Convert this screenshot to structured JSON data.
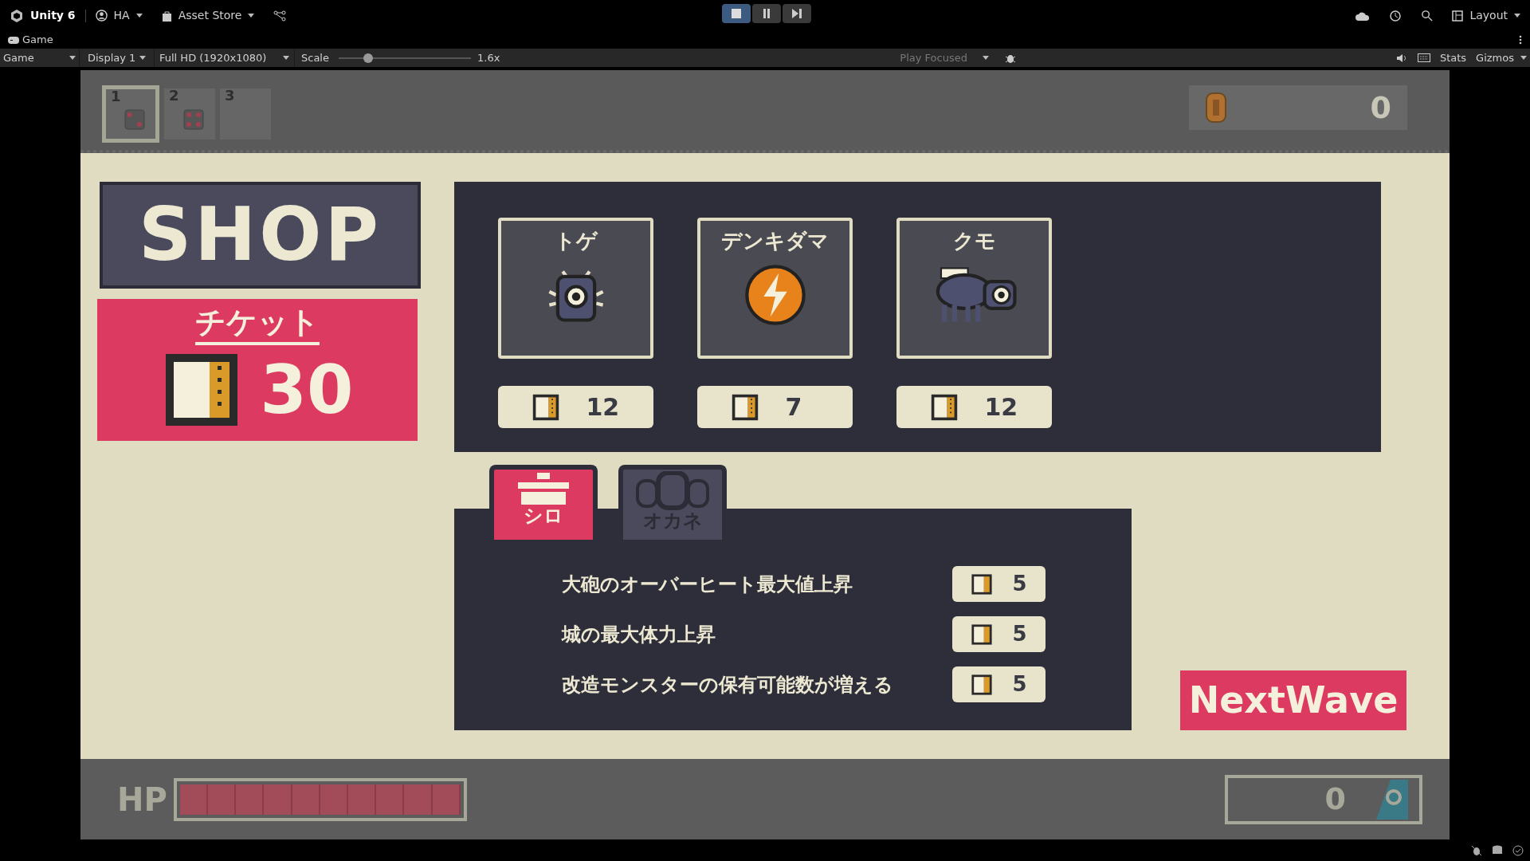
{
  "editor": {
    "app": "Unity 6",
    "account": "HA",
    "asset_store": "Asset Store",
    "layout": "Layout"
  },
  "play_controls": [
    {
      "kind": "stop",
      "selected": true
    },
    {
      "kind": "pause",
      "selected": false
    },
    {
      "kind": "step",
      "selected": false
    }
  ],
  "game_tab": "Game",
  "game_toolbar": {
    "view": "Game",
    "display": "Display 1",
    "resolution": "Full HD (1920x1080)",
    "scale_label": "Scale",
    "scale": {
      "level": 0.22
    },
    "scale_value": "1.6x",
    "play_mode": "Play Focused",
    "stats": "Stats",
    "gizmos": "Gizmos"
  },
  "hud": {
    "slots": [
      {
        "label": "1",
        "selected": true
      },
      {
        "label": "2",
        "selected": false
      },
      {
        "label": "3",
        "selected": false
      }
    ],
    "coins": "0",
    "hp_label": "HP",
    "hp": {
      "level": 1
    },
    "counter": "0"
  },
  "shop": {
    "title": "SHOP",
    "ticket_label": "チケット",
    "tickets": "30",
    "monsters": [
      {
        "kind": "spike",
        "name": "トゲ",
        "price": "12"
      },
      {
        "kind": "orb",
        "name": "デンキダマ",
        "price": "7"
      },
      {
        "kind": "spider",
        "name": "クモ",
        "price": "12"
      }
    ],
    "tabs": [
      {
        "kind": "castle",
        "label": "シロ",
        "selected": true
      },
      {
        "kind": "money",
        "label": "オカネ",
        "selected": false
      }
    ],
    "upgrades": [
      {
        "name": "大砲のオーバーヒート最大値上昇",
        "price": "5"
      },
      {
        "name": "城の最大体力上昇",
        "price": "5"
      },
      {
        "name": "改造モンスターの保有可能数が増える",
        "price": "5"
      }
    ],
    "next_button": "NextWave"
  }
}
